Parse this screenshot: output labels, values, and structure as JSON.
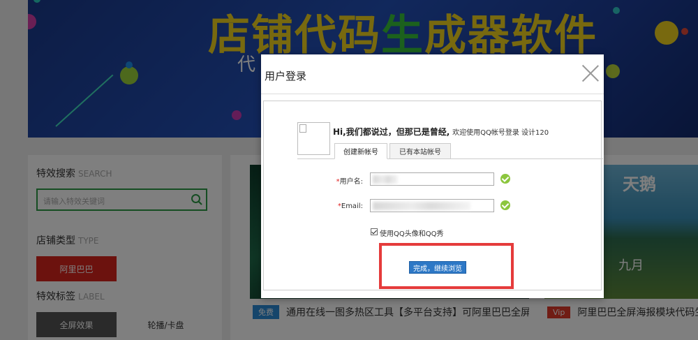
{
  "banner": {
    "title_yellow_1": "店铺代码",
    "title_green": "生",
    "title_yellow_2": "成器软件",
    "subtitle_visible": "代"
  },
  "sidebar": {
    "search_heading": "特效搜索",
    "search_heading_extra": "SEARCH",
    "search_placeholder": "请输入特效关键词",
    "shop_type_heading": "店铺类型",
    "shop_type_extra": "TYPE",
    "shop_type_button": "阿里巴巴",
    "tags_heading": "特效标签",
    "tags_extra": "LABEL",
    "tag_left": "全屏效果",
    "tag_right": "轮播/卡盘"
  },
  "cards": [
    {
      "badge": "免费",
      "badge_color": "#2a8bd6",
      "title": "通用在线一图多热区工具【多平台支持】可阿里巴巴全屏"
    },
    {
      "badge": "Vip",
      "badge_color": "#e03a2a",
      "title": "阿里巴巴全屏海报模块代码生成"
    }
  ],
  "right_thumbs": {
    "top_text": "天鹅",
    "bottom_text": "九月"
  },
  "modal": {
    "title": "用户登录",
    "greeting_bold": "Hi,我们都说过，但那已是曾经,",
    "greeting_small": "欢迎使用QQ帐号登录 设计120",
    "tabs": [
      "创建新帐号",
      "已有本站帐号"
    ],
    "username_label": "用户名:",
    "email_label": "Email:",
    "required_mark": "*",
    "checkbox_label": "使用QQ头像和QQ秀",
    "checkbox_checked": true,
    "submit_label": "完成，继续浏览"
  },
  "colors": {
    "accent_green": "#2a9a45",
    "shop_button_red": "#d9251c",
    "submit_blue": "#2d78c6",
    "highlight_red": "#e53b3b",
    "check_green": "#8cc63e"
  }
}
